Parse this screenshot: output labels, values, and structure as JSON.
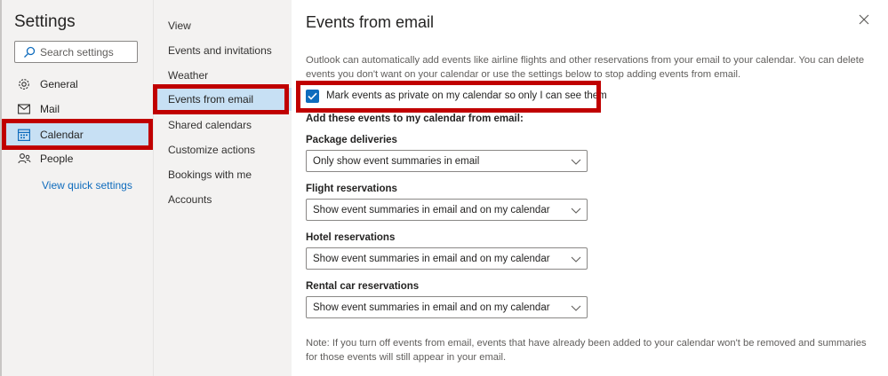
{
  "settings_panel": {
    "title": "Settings",
    "search_placeholder": "Search settings",
    "nav": [
      {
        "label": "General",
        "icon": "gear-icon"
      },
      {
        "label": "Mail",
        "icon": "mail-icon"
      },
      {
        "label": "Calendar",
        "icon": "calendar-icon",
        "selected": true
      },
      {
        "label": "People",
        "icon": "people-icon"
      }
    ],
    "quick_settings_link": "View quick settings"
  },
  "calendar_subnav": {
    "items": [
      {
        "label": "View"
      },
      {
        "label": "Events and invitations"
      },
      {
        "label": "Weather"
      },
      {
        "label": "Events from email",
        "selected": true
      },
      {
        "label": "Shared calendars"
      },
      {
        "label": "Customize actions"
      },
      {
        "label": "Bookings with me"
      },
      {
        "label": "Accounts"
      }
    ]
  },
  "main": {
    "title": "Events from email",
    "intro": "Outlook can automatically add events like airline flights and other reservations from your email to your calendar. You can delete events you don't want on your calendar or use the settings below to stop adding events from email.",
    "private_checkbox": {
      "label": "Mark events as private on my calendar so only I can see them",
      "checked": true
    },
    "section_heading": "Add these events to my calendar from email:",
    "groups": [
      {
        "label": "Package deliveries",
        "value": "Only show event summaries in email"
      },
      {
        "label": "Flight reservations",
        "value": "Show event summaries in email and on my calendar"
      },
      {
        "label": "Hotel reservations",
        "value": "Show event summaries in email and on my calendar"
      },
      {
        "label": "Rental car reservations",
        "value": "Show event summaries in email and on my calendar"
      }
    ],
    "note": "Note: If you turn off events from email, events that have already been added to your calendar won't be removed and summaries for those events will still appear in your email."
  },
  "colors": {
    "accent": "#0f6cbd",
    "selected_bg": "#c7e0f4",
    "highlight_box": "#c00000",
    "panel_bg": "#f3f2f1"
  }
}
